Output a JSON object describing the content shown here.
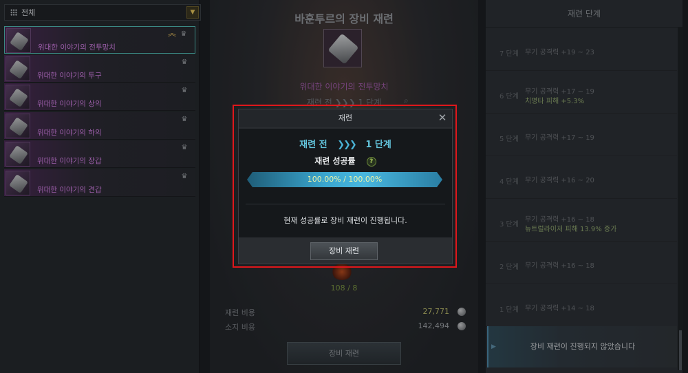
{
  "filter": {
    "label": "전체"
  },
  "items": [
    {
      "name": "위대한 이야기의 전투망치",
      "selected": true
    },
    {
      "name": "위대한 이야기의 투구"
    },
    {
      "name": "위대한 이야기의 상의"
    },
    {
      "name": "위대한 이야기의 하의"
    },
    {
      "name": "위대한 이야기의 장갑"
    },
    {
      "name": "위대한 이야기의 견갑"
    }
  ],
  "center": {
    "title": "바훈투르의 장비 재련",
    "item_name": "위대한 이야기의 전투망치",
    "stage_before": "재련 전",
    "stage_after": "1 단계",
    "material_count": "108 / 8",
    "cost_label": "재련 비용",
    "cost_value": "27,771",
    "owned_label": "소지 비용",
    "owned_value": "142,494",
    "button": "장비 재련"
  },
  "right": {
    "title": "재련 단계",
    "stages": [
      {
        "num": "7 단계",
        "line1": "무기 공격력 +19 ~ 23",
        "line2": ""
      },
      {
        "num": "6 단계",
        "line1": "무기 공격력 +17 ~ 19",
        "line2": "치명타 피해 +5.3%"
      },
      {
        "num": "5 단계",
        "line1": "무기 공격력 +17 ~ 19",
        "line2": ""
      },
      {
        "num": "4 단계",
        "line1": "무기 공격력 +16 ~ 20",
        "line2": ""
      },
      {
        "num": "3 단계",
        "line1": "무기 공격력 +16 ~ 18",
        "line2": "뉴트럴라이저 피해 13.9% 증가"
      },
      {
        "num": "2 단계",
        "line1": "무기 공격력 +16 ~ 18",
        "line2": ""
      },
      {
        "num": "1 단계",
        "line1": "무기 공격력 +14 ~ 18",
        "line2": ""
      }
    ],
    "status": "장비 재련이 진행되지 않았습니다"
  },
  "modal": {
    "title": "재련",
    "stage_before": "재련 전",
    "chevrons": "❯❯❯",
    "stage_after": "1 단계",
    "rate_label": "재련 성공률",
    "help": "?",
    "rate_value": "100.00% / 100.00%",
    "rate_fraction": 1.0,
    "message": "현재 성공률로 장비 재련이 진행됩니다.",
    "button": "장비 재련",
    "close": "✕"
  }
}
